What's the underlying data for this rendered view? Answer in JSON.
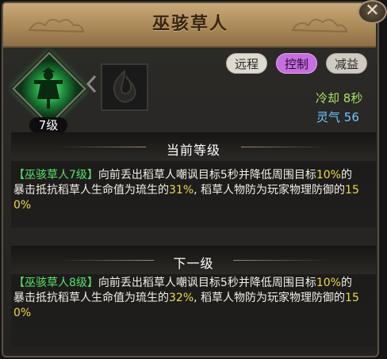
{
  "title": "巫骇草人",
  "close_icon": "close-x-icon",
  "skill": {
    "icon": "scarecrow-skill-icon",
    "level": "7级",
    "secondary_icon": "flame-emblem-icon"
  },
  "tags": [
    "远程",
    "控制",
    "减益"
  ],
  "stats": {
    "cooldown_label": "冷却",
    "cooldown_value": "8秒",
    "qi_label": "灵气",
    "qi_value": "56"
  },
  "current": {
    "header": "当前等级",
    "name": "【巫骇草人7级】",
    "text_a": "向前丢出稻草人嘲讽目标5秒并降低周围目标",
    "p1": "10%",
    "text_b": "的暴击抵抗稻草人生命值为琉生的",
    "p2": "31%",
    "text_c": ", 稻草人物防为玩家物理防御的",
    "p3": "150%"
  },
  "next": {
    "header": "下一级",
    "name": "【巫骇草人8级】",
    "text_a": "向前丢出稻草人嘲讽目标5秒并降低周围目标",
    "p1": "10%",
    "text_b": "的暴击抵抗稻草人生命值为琉生的",
    "p2": "32%",
    "text_c": ", 稻草人物防为玩家物理防御的",
    "p3": "150%"
  },
  "colors": {
    "tag_active": "#c76fe0",
    "cooldown": "#a6e36a",
    "qi": "#6fc8ff",
    "highlight_green": "#58e06a",
    "highlight_yellow": "#f0d94a"
  }
}
